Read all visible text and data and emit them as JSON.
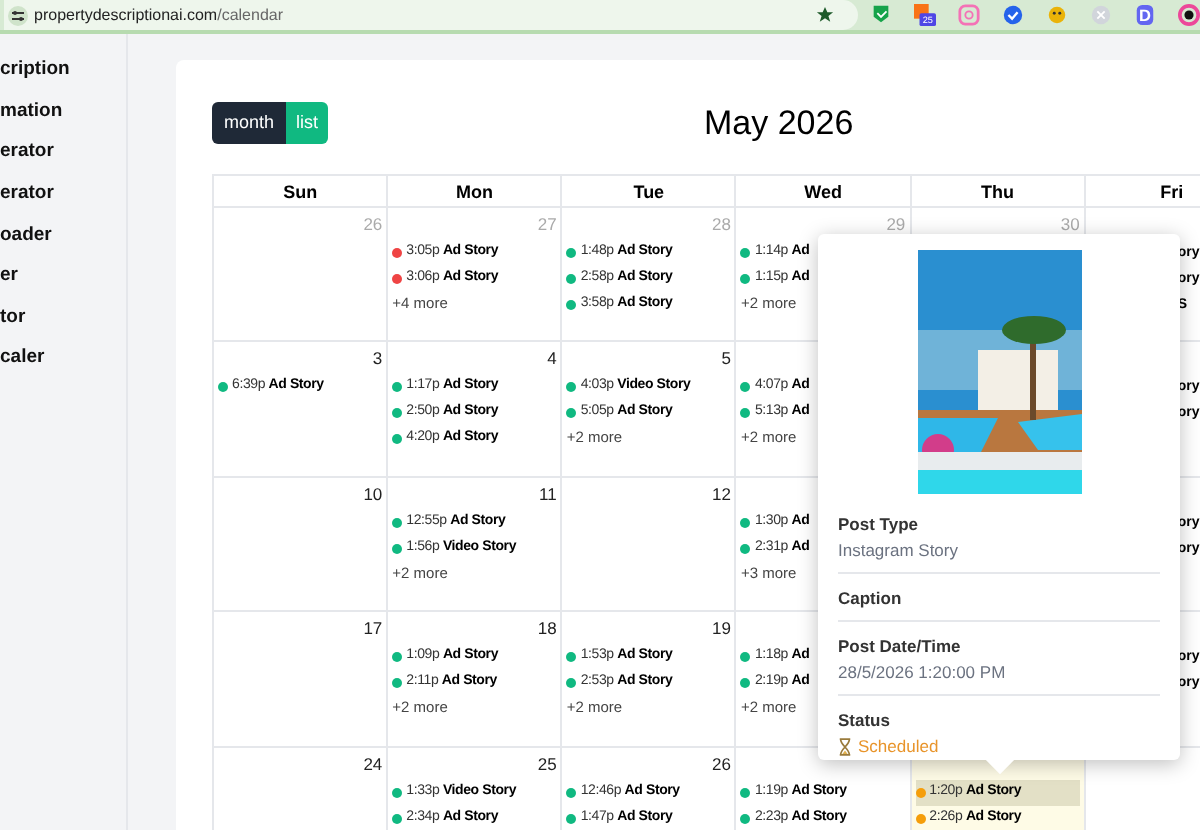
{
  "browser": {
    "url_host": "propertydescriptionai.com",
    "url_path": "/calendar",
    "extensions": [
      {
        "kind": "flag",
        "color": "#16a34a"
      },
      {
        "kind": "badge",
        "color": "#f97316",
        "badge": "25"
      },
      {
        "kind": "square",
        "color": "#f472b6"
      },
      {
        "kind": "check",
        "color": "#2563eb"
      },
      {
        "kind": "face",
        "color": "#eab308"
      },
      {
        "kind": "circle",
        "color": "#d1d5db"
      },
      {
        "kind": "letter",
        "color": "#6366f1",
        "letter": "D"
      },
      {
        "kind": "ring",
        "color": "#ec4899"
      }
    ]
  },
  "sidebar": {
    "items": [
      "cription",
      "mation",
      "erator",
      "erator",
      "oader",
      "er",
      "tor",
      "caler"
    ]
  },
  "view_toggle": [
    {
      "label": "month",
      "selected": true
    },
    {
      "label": "list",
      "selected": false
    }
  ],
  "calendar": {
    "title": "May 2026",
    "weekdays": [
      "Sun",
      "Mon",
      "Tue",
      "Wed",
      "Thu",
      "Fri"
    ],
    "weeks": [
      {
        "days": [
          {
            "day": "26",
            "outside": true,
            "today": false
          },
          {
            "day": "27",
            "outside": true,
            "today": false,
            "events": [
              {
                "time": "3:05p",
                "title": "Ad Story",
                "color": "#ef4444",
                "selected": false
              },
              {
                "time": "3:06p",
                "title": "Ad Story",
                "color": "#ef4444",
                "selected": false
              }
            ],
            "more": "+4 more"
          },
          {
            "day": "28",
            "outside": true,
            "today": false,
            "events": [
              {
                "time": "1:48p",
                "title": "Ad Story",
                "color": "#10b981",
                "selected": false
              },
              {
                "time": "2:58p",
                "title": "Ad Story",
                "color": "#10b981",
                "selected": false
              },
              {
                "time": "3:58p",
                "title": "Ad Story",
                "color": "#10b981",
                "selected": false
              }
            ]
          },
          {
            "day": "29",
            "outside": true,
            "today": false,
            "events": [
              {
                "time": "1:14p",
                "title": "Ad",
                "color": "#10b981",
                "selected": false
              },
              {
                "time": "1:15p",
                "title": "Ad",
                "color": "#10b981",
                "selected": false
              }
            ],
            "more": "+2 more"
          },
          {
            "day": "30",
            "outside": true,
            "today": false
          }
        ],
        "fri_events": [
          "ory",
          "ory",
          "S"
        ]
      },
      {
        "days": [
          {
            "day": "3",
            "outside": false,
            "today": false,
            "events": [
              {
                "time": "6:39p",
                "title": "Ad Story",
                "color": "#10b981",
                "selected": false
              }
            ]
          },
          {
            "day": "4",
            "outside": false,
            "today": false,
            "events": [
              {
                "time": "1:17p",
                "title": "Ad Story",
                "color": "#10b981",
                "selected": false
              },
              {
                "time": "2:50p",
                "title": "Ad Story",
                "color": "#10b981",
                "selected": false
              },
              {
                "time": "4:20p",
                "title": "Ad Story",
                "color": "#10b981",
                "selected": false
              }
            ]
          },
          {
            "day": "5",
            "outside": false,
            "today": false,
            "events": [
              {
                "time": "4:03p",
                "title": "Video Story",
                "color": "#10b981",
                "selected": false
              },
              {
                "time": "5:05p",
                "title": "Ad Story",
                "color": "#10b981",
                "selected": false
              }
            ],
            "more": "+2 more"
          },
          {
            "today": false,
            "events": [
              {
                "time": "4:07p",
                "title": "Ad",
                "color": "#10b981",
                "selected": false
              },
              {
                "time": "5:13p",
                "title": "Ad",
                "color": "#10b981",
                "selected": false
              }
            ],
            "more": "+2 more"
          }
        ],
        "fri_events": [
          "ory",
          "ory"
        ]
      },
      {
        "days": [
          {
            "day": "10",
            "outside": false,
            "today": false
          },
          {
            "day": "11",
            "outside": false,
            "today": false,
            "events": [
              {
                "time": "12:55p",
                "title": "Ad Story",
                "color": "#10b981",
                "selected": false
              },
              {
                "time": "1:56p",
                "title": "Video Story",
                "color": "#10b981",
                "selected": false
              }
            ],
            "more": "+2 more"
          },
          {
            "day": "12",
            "outside": false,
            "today": false
          },
          {
            "today": false,
            "events": [
              {
                "time": "1:30p",
                "title": "Ad",
                "color": "#10b981",
                "selected": false
              },
              {
                "time": "2:31p",
                "title": "Ad",
                "color": "#10b981",
                "selected": false
              }
            ],
            "more": "+3 more"
          }
        ],
        "fri_events": [
          "ory",
          "ory"
        ]
      },
      {
        "days": [
          {
            "day": "17",
            "outside": false,
            "today": false
          },
          {
            "day": "18",
            "outside": false,
            "today": false,
            "events": [
              {
                "time": "1:09p",
                "title": "Ad Story",
                "color": "#10b981",
                "selected": false
              },
              {
                "time": "2:11p",
                "title": "Ad Story",
                "color": "#10b981",
                "selected": false
              }
            ],
            "more": "+2 more"
          },
          {
            "day": "19",
            "outside": false,
            "today": false,
            "events": [
              {
                "time": "1:53p",
                "title": "Ad Story",
                "color": "#10b981",
                "selected": false
              },
              {
                "time": "2:53p",
                "title": "Ad Story",
                "color": "#10b981",
                "selected": false
              }
            ],
            "more": "+2 more"
          },
          {
            "today": false,
            "events": [
              {
                "time": "1:18p",
                "title": "Ad",
                "color": "#10b981",
                "selected": false
              },
              {
                "time": "2:19p",
                "title": "Ad",
                "color": "#10b981",
                "selected": false
              }
            ],
            "more": "+2 more"
          }
        ],
        "fri_events": [
          "ory",
          "ory"
        ]
      },
      {
        "days": [
          {
            "day": "24",
            "outside": false,
            "today": false
          },
          {
            "day": "25",
            "outside": false,
            "today": false,
            "events": [
              {
                "time": "1:33p",
                "title": "Video Story",
                "color": "#10b981",
                "selected": false
              },
              {
                "time": "2:34p",
                "title": "Ad Story",
                "color": "#10b981",
                "selected": false
              }
            ]
          },
          {
            "day": "26",
            "outside": false,
            "today": false,
            "events": [
              {
                "time": "12:46p",
                "title": "Ad Story",
                "color": "#10b981",
                "selected": false
              },
              {
                "time": "1:47p",
                "title": "Ad Story",
                "color": "#10b981",
                "selected": false
              }
            ]
          },
          {
            "today": false,
            "events": [
              {
                "time": "1:19p",
                "title": "Ad Story",
                "color": "#10b981",
                "selected": false
              },
              {
                "time": "2:23p",
                "title": "Ad Story",
                "color": "#10b981",
                "selected": false
              }
            ]
          },
          {
            "today": true,
            "events": [
              {
                "time": "1:20p",
                "title": "Ad Story",
                "color": "#f59e0b",
                "selected": true
              },
              {
                "time": "2:26p",
                "title": "Ad Story",
                "color": "#f59e0b",
                "selected": false
              }
            ]
          }
        ]
      }
    ]
  },
  "popup": {
    "fields": [
      {
        "label": "Post Type",
        "value": "Instagram Story"
      },
      {
        "label": "Caption"
      },
      {
        "label": "Post Date/Time",
        "value": "28/5/2026 1:20:00 PM"
      },
      {
        "label": "Status",
        "value": "Scheduled",
        "kind": "status"
      }
    ]
  }
}
